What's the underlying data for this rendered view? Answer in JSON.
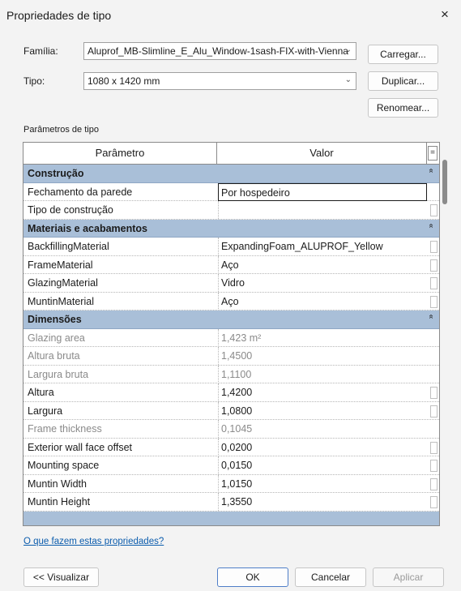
{
  "window": {
    "title": "Propriedades de tipo",
    "close_glyph": "×"
  },
  "familia": {
    "label": "Família:",
    "value": "Aluprof_MB-Slimline_E_Alu_Window-1sash-FIX-with-Vienna"
  },
  "tipo": {
    "label": "Tipo:",
    "value": "1080 x 1420 mm"
  },
  "buttons": {
    "carregar": "Carregar...",
    "duplicar": "Duplicar...",
    "renomear": "Renomear...",
    "visualizar": "<< Visualizar",
    "ok": "OK",
    "cancelar": "Cancelar",
    "aplicar": "Aplicar"
  },
  "params_label": "Parâmetros de tipo",
  "grid": {
    "col_param": "Parâmetro",
    "col_valor": "Valor",
    "col_menu": "=",
    "groups": [
      {
        "name": "Construção",
        "rows": [
          {
            "name": "Fechamento da parede",
            "value": "Por hospedeiro",
            "selected": true
          },
          {
            "name": "Tipo de construção",
            "value": ""
          }
        ]
      },
      {
        "name": "Materiais e acabamentos",
        "rows": [
          {
            "name": "BackfillingMaterial",
            "value": "ExpandingFoam_ALUPROF_Yellow"
          },
          {
            "name": "FrameMaterial",
            "value": "Aço"
          },
          {
            "name": "GlazingMaterial",
            "value": "Vidro"
          },
          {
            "name": "MuntinMaterial",
            "value": "Aço"
          }
        ]
      },
      {
        "name": "Dimensões",
        "rows": [
          {
            "name": "Glazing area",
            "value": "1,423 m²",
            "readonly": true
          },
          {
            "name": "Altura bruta",
            "value": "1,4500",
            "readonly": true
          },
          {
            "name": "Largura bruta",
            "value": "1,1100",
            "readonly": true
          },
          {
            "name": "Altura",
            "value": "1,4200"
          },
          {
            "name": "Largura",
            "value": "1,0800"
          },
          {
            "name": "Frame thickness",
            "value": "0,1045",
            "readonly": true
          },
          {
            "name": "Exterior wall face offset",
            "value": "0,0200"
          },
          {
            "name": "Mounting space",
            "value": "0,0150"
          },
          {
            "name": "Muntin Width",
            "value": "1,0150"
          },
          {
            "name": "Muntin Height",
            "value": "1,3550"
          }
        ]
      }
    ]
  },
  "help_link": "O que fazem estas propriedades?",
  "icons": {
    "combo_arrow": "chevron-down-icon",
    "collapse": "collapse-icon",
    "close": "close-icon"
  }
}
